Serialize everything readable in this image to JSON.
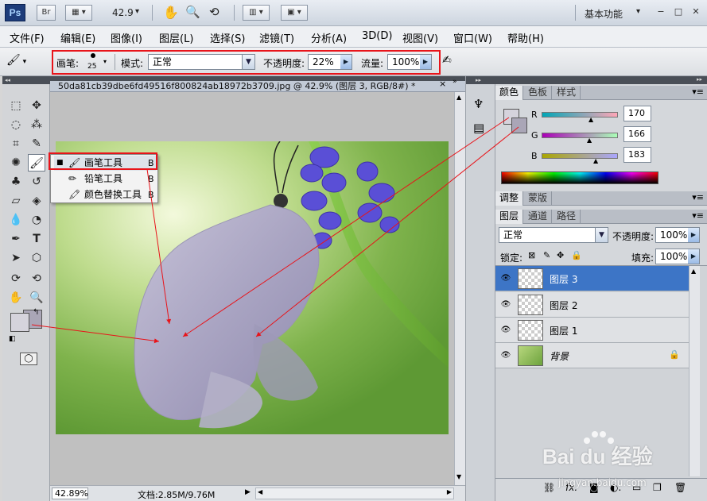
{
  "app": {
    "logo": "Ps",
    "bridge_btn": "Br",
    "zoom_value": "42.9",
    "workspace": "基本功能"
  },
  "menu": [
    "文件(F)",
    "编辑(E)",
    "图像(I)",
    "图层(L)",
    "选择(S)",
    "滤镜(T)",
    "分析(A)",
    "3D(D)",
    "视图(V)",
    "窗口(W)",
    "帮助(H)"
  ],
  "options": {
    "brush_label": "画笔:",
    "brush_size": "25",
    "mode_label": "模式:",
    "mode_value": "正常",
    "opacity_label": "不透明度:",
    "opacity_value": "22%",
    "flow_label": "流量:",
    "flow_value": "100%"
  },
  "document": {
    "tab_title": "50da81cb39dbe6fd49516f800824ab18972b3709.jpg @ 42.9% (图层 3, RGB/8#) *",
    "close": "×"
  },
  "flyout": [
    {
      "marker": "■",
      "label": "画笔工具",
      "key": "B"
    },
    {
      "marker": "",
      "label": "铅笔工具",
      "key": "B"
    },
    {
      "marker": "",
      "label": "颜色替换工具",
      "key": "B"
    }
  ],
  "status": {
    "zoom": "42.89%",
    "doc_info": "文档:2.85M/9.76M"
  },
  "color_panel": {
    "tabs": [
      "颜色",
      "色板",
      "样式"
    ],
    "r_label": "R",
    "r_value": "170",
    "g_label": "G",
    "g_value": "166",
    "b_label": "B",
    "b_value": "183"
  },
  "adjust_panel": {
    "tabs": [
      "调整",
      "蒙版"
    ]
  },
  "layers_panel": {
    "tabs": [
      "图层",
      "通道",
      "路径"
    ],
    "blend_mode": "正常",
    "opacity_label": "不透明度:",
    "opacity_value": "100%",
    "lock_label": "锁定:",
    "fill_label": "填充:",
    "fill_value": "100%",
    "layers": [
      {
        "name": "图层 3",
        "active": true
      },
      {
        "name": "图层 2",
        "active": false
      },
      {
        "name": "图层 1",
        "active": false
      },
      {
        "name": "背景",
        "active": false
      }
    ]
  },
  "watermark": {
    "brand": "Bai du 经验",
    "url": "jingyan.baidu.com"
  },
  "colors": {
    "accent_red": "#e8141a",
    "fg_swatch": "#aaa6b7",
    "active_layer": "#3d75c6"
  }
}
